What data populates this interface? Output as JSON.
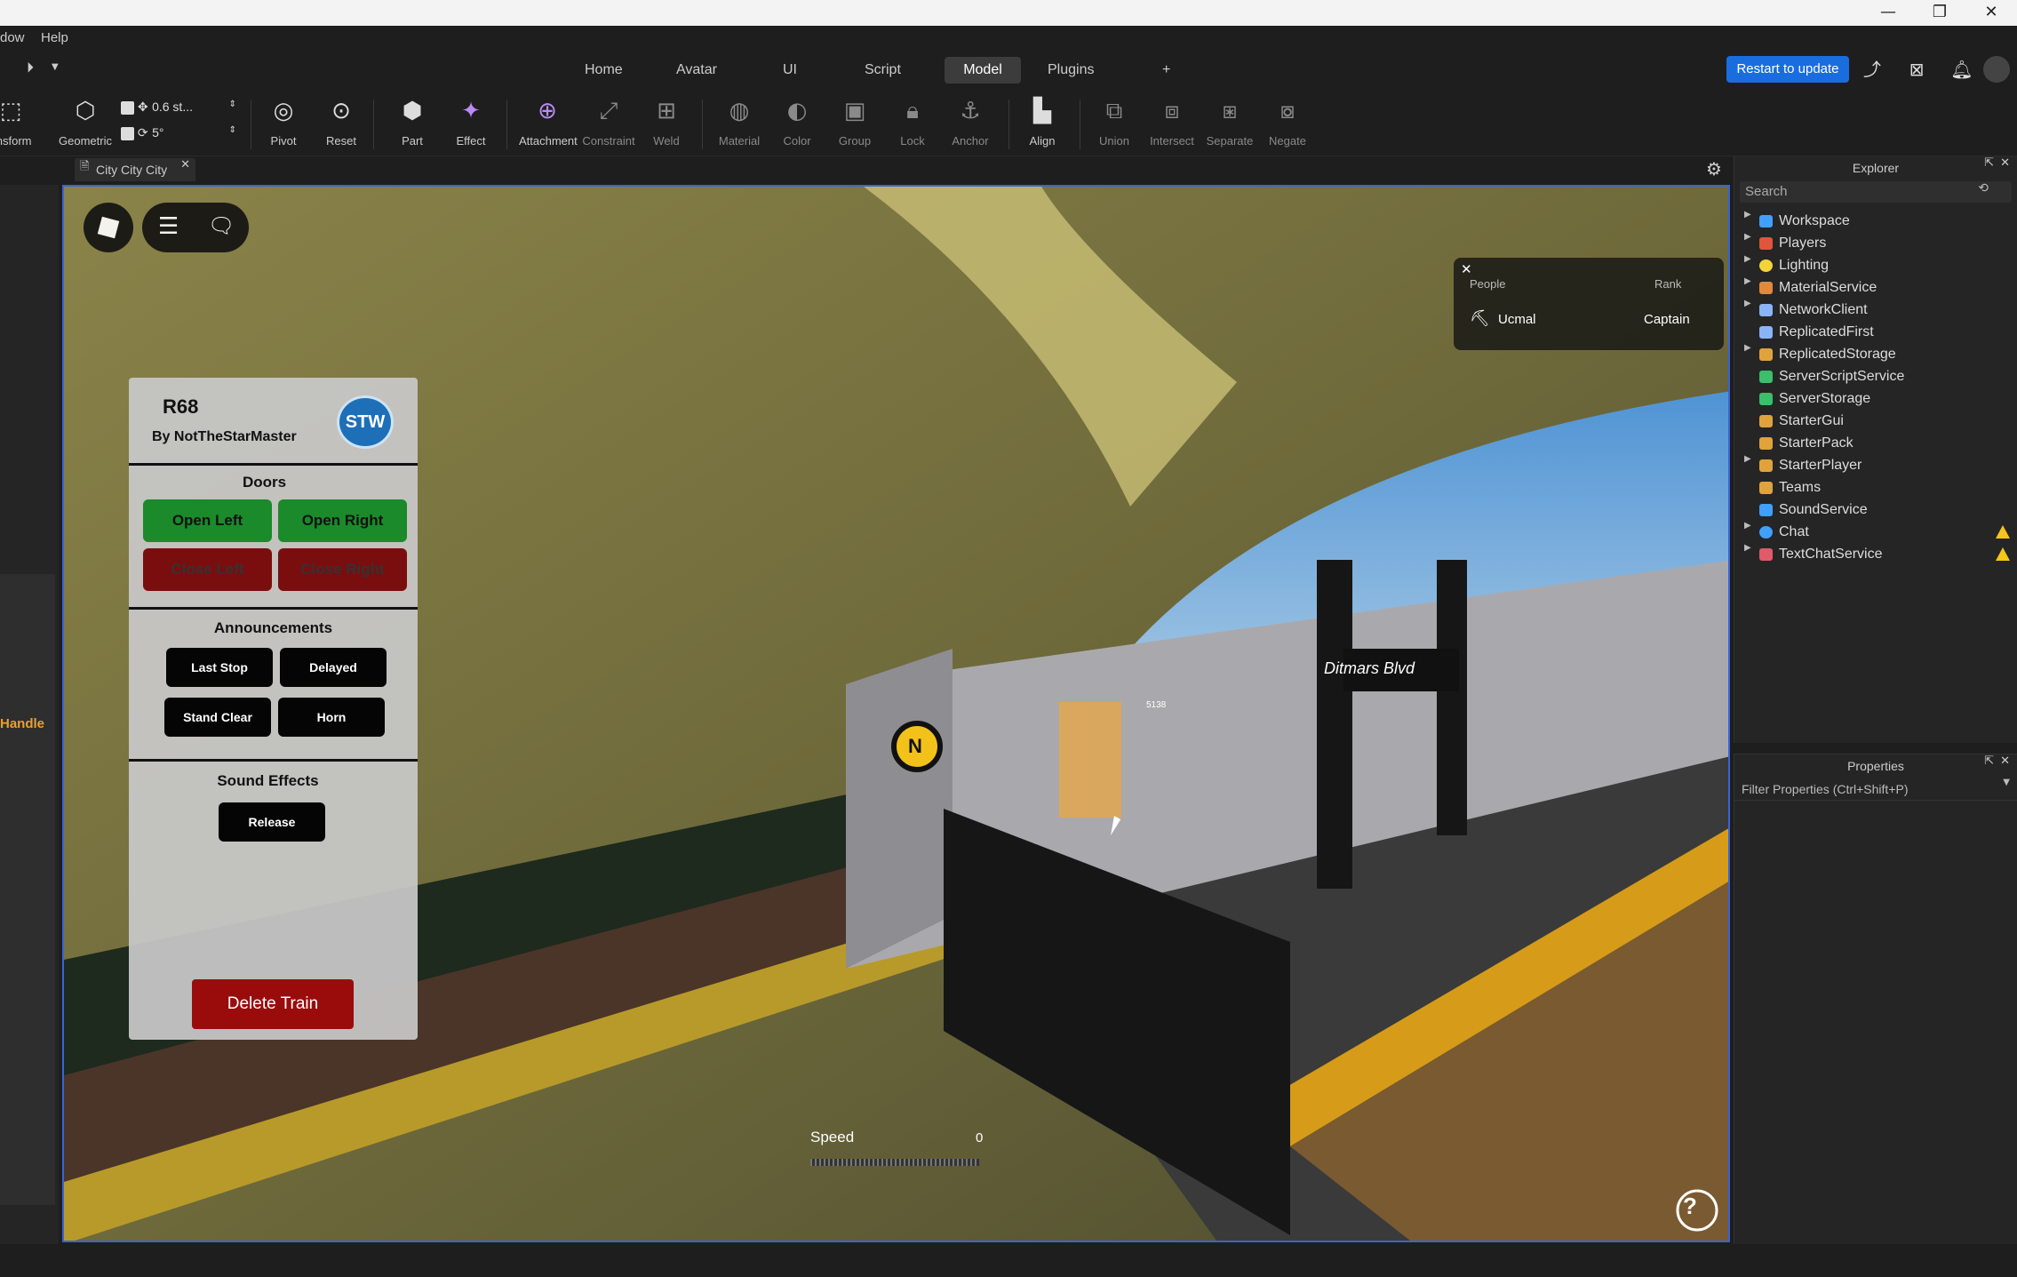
{
  "window": {
    "minimize": "—",
    "maximize": "❐",
    "close": "✕"
  },
  "menu": {
    "items": [
      "dow",
      "Help"
    ]
  },
  "ribbon": {
    "tabs": [
      "Home",
      "Avatar",
      "UI",
      "Script",
      "Model",
      "Plugins"
    ],
    "active_tab": "Model",
    "add_tab": "+",
    "restart_label": "Restart to update"
  },
  "toolbar": {
    "transform_label": "ansform",
    "geometric_label": "Geometric",
    "move_step": "0.6 st...",
    "rotate_step": "5°",
    "tools": [
      {
        "label": "Pivot"
      },
      {
        "label": "Reset"
      },
      {
        "label": "Part"
      },
      {
        "label": "Effect"
      },
      {
        "label": "Attachment"
      },
      {
        "label": "Constraint"
      },
      {
        "label": "Weld"
      },
      {
        "label": "Material"
      },
      {
        "label": "Color"
      },
      {
        "label": "Group"
      },
      {
        "label": "Lock"
      },
      {
        "label": "Anchor"
      },
      {
        "label": "Align"
      },
      {
        "label": "Union"
      },
      {
        "label": "Intersect"
      },
      {
        "label": "Separate"
      },
      {
        "label": "Negate"
      }
    ]
  },
  "document": {
    "tab_title": "City City City"
  },
  "left_panel": {
    "handle_label": "Handle"
  },
  "explorer": {
    "title": "Explorer",
    "search_placeholder": "Search",
    "items": [
      {
        "label": "Workspace",
        "color": "#3fa0ff"
      },
      {
        "label": "Players",
        "color": "#e0553b"
      },
      {
        "label": "Lighting",
        "color": "#f2d43a"
      },
      {
        "label": "MaterialService",
        "color": "#e08a3b"
      },
      {
        "label": "NetworkClient",
        "color": "#8ab4f8"
      },
      {
        "label": "ReplicatedFirst",
        "color": "#8ab4f8"
      },
      {
        "label": "ReplicatedStorage",
        "color": "#e0a33b"
      },
      {
        "label": "ServerScriptService",
        "color": "#3bbf6a"
      },
      {
        "label": "ServerStorage",
        "color": "#3bbf6a"
      },
      {
        "label": "StarterGui",
        "color": "#e0a33b"
      },
      {
        "label": "StarterPack",
        "color": "#e0a33b"
      },
      {
        "label": "StarterPlayer",
        "color": "#e0a33b"
      },
      {
        "label": "Teams",
        "color": "#e0a33b"
      },
      {
        "label": "SoundService",
        "color": "#3fa0ff"
      },
      {
        "label": "Chat",
        "color": "#3fa0ff"
      },
      {
        "label": "TextChatService",
        "color": "#e05a6a"
      }
    ]
  },
  "properties": {
    "title": "Properties",
    "filter_placeholder": "Filter Properties (Ctrl+Shift+P)"
  },
  "game": {
    "leaderboard": {
      "col_people": "People",
      "col_rank": "Rank",
      "player": "Ucmal",
      "rank": "Captain"
    },
    "train_panel": {
      "title": "R68",
      "author": "By NotTheStarMaster",
      "logo_text": "STW",
      "doors_title": "Doors",
      "open_left": "Open Left",
      "open_right": "Open Right",
      "close_left": "Close Left",
      "close_right": "Close Right",
      "announcements_title": "Announcements",
      "last_stop": "Last Stop",
      "delayed": "Delayed",
      "stand_clear": "Stand Clear",
      "horn": "Horn",
      "sound_effects_title": "Sound Effects",
      "release": "Release",
      "delete_train": "Delete Train"
    },
    "speed": {
      "label": "Speed",
      "value": "0"
    },
    "station_sign": "Ditmars Blvd",
    "train_route": "N",
    "car_number": "5138"
  }
}
